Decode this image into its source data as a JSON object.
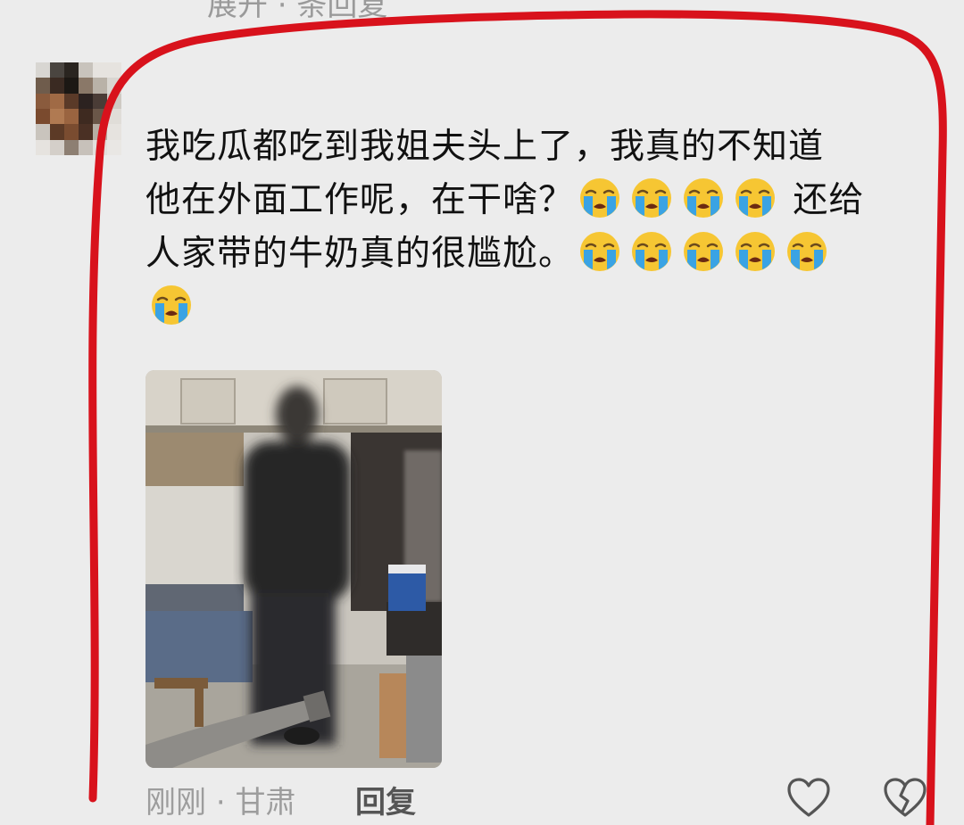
{
  "top_cut_text": "展开 · 条回复",
  "comment": {
    "lines": [
      {
        "text": "我吃瓜都吃到我姐夫头上了，我真的不知道",
        "emoji_count": 0
      },
      {
        "text": "他在外面工作呢，在干啥？",
        "emoji_count": 4,
        "tail": " 还给"
      },
      {
        "text": "人家带的牛奶真的很尴尬。",
        "emoji_count": 5,
        "tail": ""
      },
      {
        "text": "",
        "emoji_count": 1,
        "tail": ""
      }
    ],
    "emoji_name": "loudly-crying-face"
  },
  "meta": {
    "time": "刚刚",
    "separator": "·",
    "location": "甘肃"
  },
  "reply_label": "回复",
  "icons": {
    "like": "heart-outline-icon",
    "dislike": "broken-heart-icon"
  },
  "colors": {
    "annotation": "#d8121c",
    "background": "#ececec",
    "text": "#111111",
    "meta": "#9d9d9d"
  }
}
